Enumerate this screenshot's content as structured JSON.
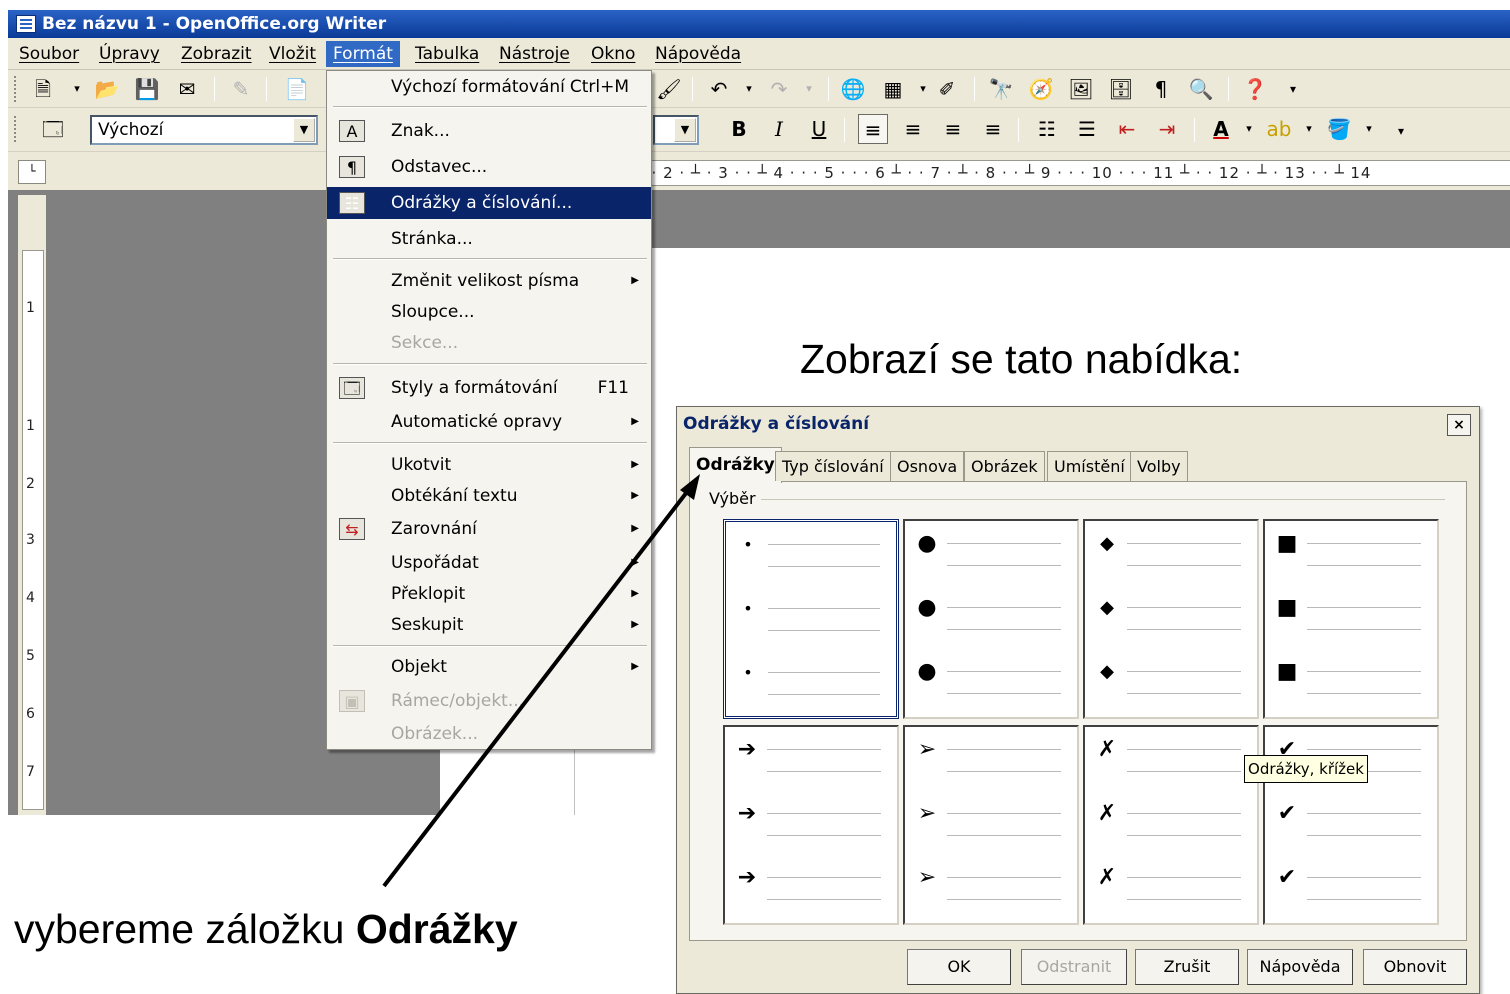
{
  "window": {
    "title": "Bez názvu 1 - OpenOffice.org Writer"
  },
  "menubar": [
    "Soubor",
    "Úpravy",
    "Zobrazit",
    "Vložit",
    "Formát",
    "Tabulka",
    "Nástroje",
    "Okno",
    "Nápověda"
  ],
  "toolbar2": {
    "style_value": "Výchozí",
    "bold": "B",
    "italic": "I",
    "underline": "U"
  },
  "ruler": {
    "h_text": "· · 2 · ┴ · 3 · · ┴ 4 · · · 5 · · · 6 ┴ · · 7 · ┴ · 8 · · ┴ 9 · · · 10 · · · 11 ┴ · · 12 · ┴ · 13 · · ┴ 14",
    "v_labels": [
      "1",
      "1",
      "2",
      "3",
      "4",
      "5",
      "6",
      "7"
    ]
  },
  "format_menu": {
    "items": [
      {
        "label": "Výchozí formátování",
        "shortcut": "Ctrl+M"
      },
      {
        "label": "Znak..."
      },
      {
        "label": "Odstavec..."
      },
      {
        "label": "Odrážky a číslování..."
      },
      {
        "label": "Stránka..."
      },
      {
        "label": "Změnit velikost písma"
      },
      {
        "label": "Sloupce..."
      },
      {
        "label": "Sekce..."
      },
      {
        "label": "Styly a formátování",
        "shortcut": "F11"
      },
      {
        "label": "Automatické opravy"
      },
      {
        "label": "Ukotvit"
      },
      {
        "label": "Obtékání textu"
      },
      {
        "label": "Zarovnání"
      },
      {
        "label": "Uspořádat"
      },
      {
        "label": "Překlopit"
      },
      {
        "label": "Seskupit"
      },
      {
        "label": "Objekt"
      },
      {
        "label": "Rámec/objekt..."
      },
      {
        "label": "Obrázek..."
      }
    ]
  },
  "annotations": {
    "top": "Zobrazí se tato nabídka:",
    "bottom_prefix": "vybereme záložku ",
    "bottom_bold": "Odrážky"
  },
  "dialog": {
    "title": "Odrážky a číslování",
    "close": "×",
    "tabs": [
      "Odrážky",
      "Typ číslování",
      "Osnova",
      "Obrázek",
      "Umístění",
      "Volby"
    ],
    "group_label": "Výběr",
    "bullets": [
      "•",
      "●",
      "◆",
      "■",
      "➔",
      "➢",
      "✗",
      "✔"
    ],
    "tooltip": "Odrážky, křížek",
    "buttons": [
      "OK",
      "Odstranit",
      "Zrušit",
      "Nápověda",
      "Obnovit"
    ]
  }
}
